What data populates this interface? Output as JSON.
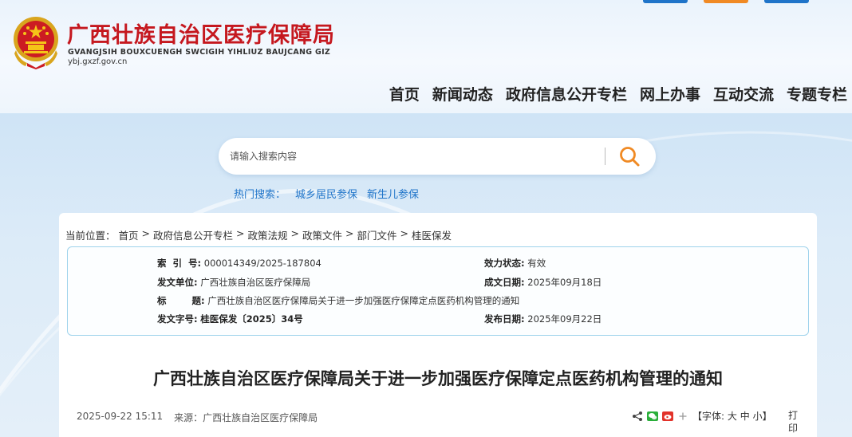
{
  "site": {
    "title": "广西壮族自治区医疗保障局",
    "subtitle": "GVANGJSIH BOUXCUENGH SWCIGIH YIHLIUZ BAUJCANG GIZ",
    "domain": "ybj.gxzf.gov.cn"
  },
  "nav": [
    "首页",
    "新闻动态",
    "政府信息公开专栏",
    "网上办事",
    "互动交流",
    "专题专栏"
  ],
  "search": {
    "placeholder": "请输入搜索内容",
    "hot_label": "热门搜索：",
    "hot_terms": [
      "城乡居民参保",
      "新生儿参保"
    ]
  },
  "breadcrumb": {
    "label": "当前位置：",
    "items": [
      "首页",
      "政府信息公开专栏",
      "政策法规",
      "政策文件",
      "部门文件",
      "桂医保发"
    ],
    "separator": ">"
  },
  "meta": {
    "index_label": "索  引  号:",
    "index_value": "000014349/2025-187804",
    "validity_label": "效力状态:",
    "validity_value": "有效",
    "issuer_label": "发文单位:",
    "issuer_value": "广西壮族自治区医疗保障局",
    "written_label": "成文日期:",
    "written_value": "2025年09月18日",
    "title_label": "标        题:",
    "title_value": "广西壮族自治区医疗保障局关于进一步加强医疗保障定点医药机构管理的通知",
    "docno_label": "发文字号:",
    "docno_value": "桂医保发〔2025〕34号",
    "published_label": "发布日期:",
    "published_value": "2025年09月22日"
  },
  "article": {
    "title": "广西壮族自治区医疗保障局关于进一步加强医疗保障定点医药机构管理的通知",
    "datetime": "2025-09-22 15:11",
    "source_label": "来源：",
    "source_value": "广西壮族自治区医疗保障局"
  },
  "tools": {
    "font_prefix": "【字体:",
    "font_large": "大",
    "font_medium": "中",
    "font_small": "小",
    "font_suffix": "】",
    "print": "打印"
  },
  "colors": {
    "brand_red": "#c5181f",
    "link_blue": "#1f74c9",
    "search_orange": "#f08a24"
  }
}
